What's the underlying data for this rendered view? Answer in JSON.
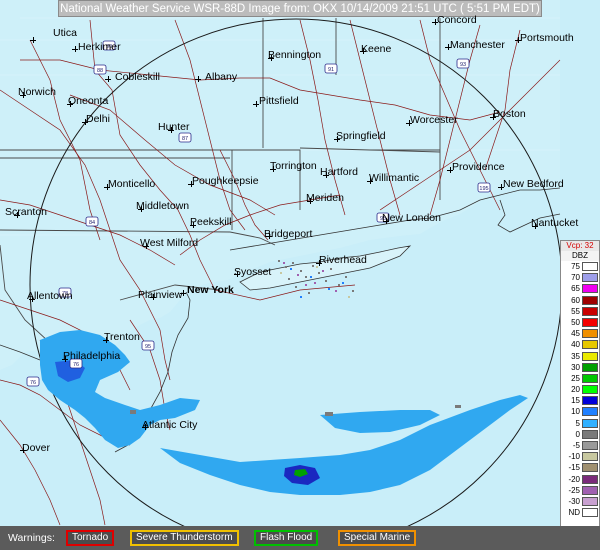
{
  "header": {
    "title": "National Weather Service WSR-88D Image from: OKX 10/14/2009 21:51 UTC ( 5:51 PM EDT)"
  },
  "cities": [
    {
      "name": "Utica"
    },
    {
      "name": "Herkimer"
    },
    {
      "name": "Cobleskill"
    },
    {
      "name": "Albany"
    },
    {
      "name": "Bennington"
    },
    {
      "name": "Keene"
    },
    {
      "name": "Concord"
    },
    {
      "name": "Manchester"
    },
    {
      "name": "Portsmouth"
    },
    {
      "name": "Norwich"
    },
    {
      "name": "Oneonta"
    },
    {
      "name": "Delhi"
    },
    {
      "name": "Hunter"
    },
    {
      "name": "Pittsfield"
    },
    {
      "name": "Springfield"
    },
    {
      "name": "Worcester"
    },
    {
      "name": "Boston"
    },
    {
      "name": "Monticello"
    },
    {
      "name": "Poughkeepsie"
    },
    {
      "name": "Torrington"
    },
    {
      "name": "Hartford"
    },
    {
      "name": "Willimantic"
    },
    {
      "name": "Providence"
    },
    {
      "name": "New Bedford"
    },
    {
      "name": "Middletown"
    },
    {
      "name": "Meriden"
    },
    {
      "name": "Scranton"
    },
    {
      "name": "Peekskill"
    },
    {
      "name": "New London"
    },
    {
      "name": "Nantucket"
    },
    {
      "name": "West Milford"
    },
    {
      "name": "Bridgeport"
    },
    {
      "name": "Syosset"
    },
    {
      "name": "Riverhead"
    },
    {
      "name": "Allentown"
    },
    {
      "name": "Plainview"
    },
    {
      "name": "New York"
    },
    {
      "name": "Trenton"
    },
    {
      "name": "Philadelphia"
    },
    {
      "name": "Atlantic City"
    },
    {
      "name": "Dover"
    }
  ],
  "routes": [
    {
      "name": "I-88"
    },
    {
      "name": "I-90"
    },
    {
      "name": "I-87"
    },
    {
      "name": "I-91"
    },
    {
      "name": "I-93"
    },
    {
      "name": "I-84"
    },
    {
      "name": "I-95"
    },
    {
      "name": "I-78"
    },
    {
      "name": "I-76"
    },
    {
      "name": "I-195"
    }
  ],
  "legend": {
    "header": "Vcp: 32",
    "unit": "DBZ",
    "rows": [
      {
        "label": "75",
        "color": "#fefefe"
      },
      {
        "label": "70",
        "color": "#9e9eea"
      },
      {
        "label": "65",
        "color": "#f000f0"
      },
      {
        "label": "60",
        "color": "#9e0000"
      },
      {
        "label": "55",
        "color": "#c80000"
      },
      {
        "label": "50",
        "color": "#f40000"
      },
      {
        "label": "45",
        "color": "#f09000"
      },
      {
        "label": "40",
        "color": "#e6c800"
      },
      {
        "label": "35",
        "color": "#eaea00"
      },
      {
        "label": "30",
        "color": "#00a000"
      },
      {
        "label": "25",
        "color": "#00c800"
      },
      {
        "label": "20",
        "color": "#00ff00"
      },
      {
        "label": "15",
        "color": "#0000d8"
      },
      {
        "label": "10",
        "color": "#2080ff"
      },
      {
        "label": "5",
        "color": "#30b0ff"
      },
      {
        "label": "0",
        "color": "#7a7a7a"
      },
      {
        "label": "-5",
        "color": "#9a9a9a"
      },
      {
        "label": "-10",
        "color": "#c8c8a0"
      },
      {
        "label": "-15",
        "color": "#a09070"
      },
      {
        "label": "-20",
        "color": "#7a2a7a"
      },
      {
        "label": "-25",
        "color": "#a060b0"
      },
      {
        "label": "-30",
        "color": "#c8a0d0"
      },
      {
        "label": "ND",
        "color": "#ffffff"
      }
    ]
  },
  "warnings": {
    "label": "Warnings:",
    "items": [
      {
        "label": "Tornado",
        "color": "#e00000"
      },
      {
        "label": "Severe Thunderstorm",
        "color": "#f0c000"
      },
      {
        "label": "Flash Flood",
        "color": "#00c000"
      },
      {
        "label": "Special Marine",
        "color": "#f09000"
      }
    ]
  }
}
